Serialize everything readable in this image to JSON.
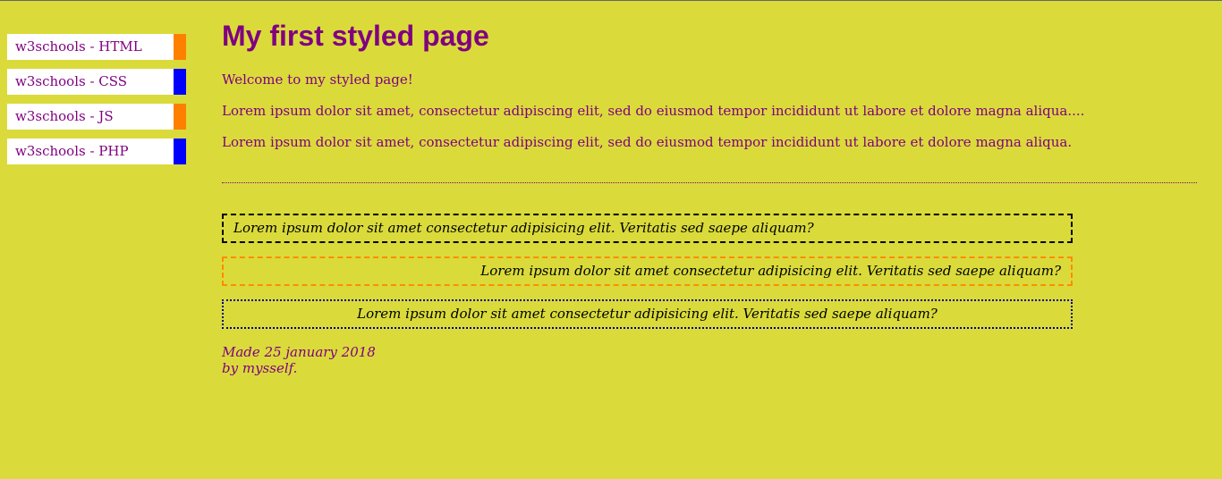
{
  "nav": {
    "items": [
      {
        "label": "w3schools - HTML",
        "accent": "#ff8000"
      },
      {
        "label": "w3schools - CSS",
        "accent": "#0000ff"
      },
      {
        "label": "w3schools - JS",
        "accent": "#ff8000"
      },
      {
        "label": "w3schools - PHP",
        "accent": "#0000ff"
      }
    ]
  },
  "main": {
    "title": "My first styled page",
    "welcome": "Welcome to my styled page!",
    "paragraphs": [
      "Lorem ipsum dolor sit amet, consectetur adipiscing elit, sed do eiusmod tempor incididunt ut labore et dolore magna aliqua....",
      "Lorem ipsum dolor sit amet, consectetur adipiscing elit, sed do eiusmod tempor incididunt ut labore et dolore magna aliqua."
    ],
    "boxes": [
      "Lorem ipsum dolor sit amet consectetur adipisicing elit. Veritatis sed saepe aliquam?",
      "Lorem ipsum dolor sit amet consectetur adipisicing elit. Veritatis sed saepe aliquam?",
      "Lorem ipsum dolor sit amet consectetur adipisicing elit. Veritatis sed saepe aliquam?"
    ]
  },
  "footer": {
    "line1": "Made 25 january 2018",
    "line2": "by mysself."
  },
  "colors": {
    "background": "#dadb3b",
    "text": "#800080"
  }
}
